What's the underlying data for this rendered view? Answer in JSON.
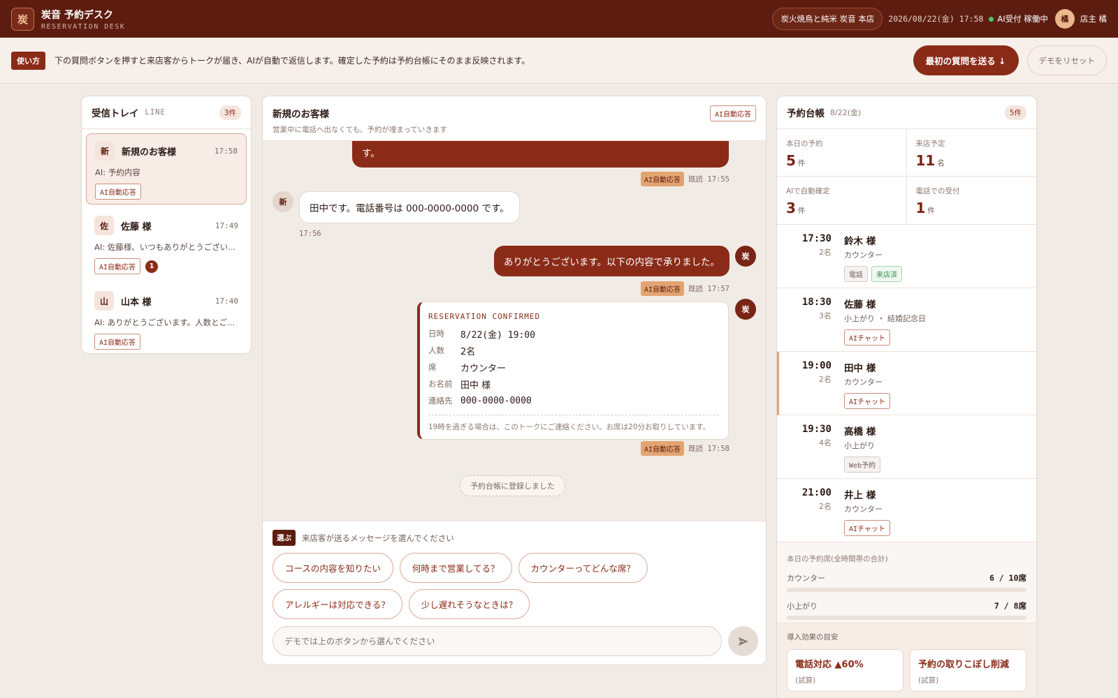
{
  "header": {
    "logo_char": "炭",
    "title": "炭音 予約デスク",
    "subtitle": "RESERVATION DESK",
    "store": "炭火焼鳥と純米 炭音 本店",
    "datetime": "2026/08/22(金) 17:58",
    "status": "AI受付 稼働中",
    "user_avatar": "橘",
    "user_name": "店主 橘"
  },
  "guide": {
    "badge": "使い方",
    "text": "下の質問ボタンを押すと来店客からトークが届き、AIが自動で返信します。確定した予約は予約台帳にそのまま反映されます。",
    "primary_button": "最初の質問を送る ↓",
    "reset_button": "デモをリセット"
  },
  "inbox": {
    "title": "受信トレイ",
    "channel": "LINE",
    "count": "3件",
    "threads": [
      {
        "avatar": "新",
        "name": "新規のお客様",
        "time": "17:58",
        "preview": "AI: 予約内容",
        "tag": "AI自動応答",
        "unread": ""
      },
      {
        "avatar": "佐",
        "name": "佐藤 様",
        "time": "17:49",
        "preview": "AI: 佐藤様、いつもありがとうござい...",
        "tag": "AI自動応答",
        "unread": "1"
      },
      {
        "avatar": "山",
        "name": "山本 様",
        "time": "17:40",
        "preview": "AI: ありがとうございます。人数とご...",
        "tag": "AI自動応答",
        "unread": ""
      }
    ]
  },
  "chat": {
    "title": "新規のお客様",
    "subtitle": "営業中に電話へ出なくても、予約が埋まっていきます",
    "mode_tag": "AI自動応答",
    "messages": {
      "m1_text": "す。",
      "m1_tag": "AI自動応答",
      "m1_meta": "既読 17:55",
      "m2_avatar": "新",
      "m2_text": "田中です。電話番号は 000-0000-0000 です。",
      "m2_time": "17:56",
      "m3_avatar": "炭",
      "m3_text": "ありがとうございます。以下の内容で承りました。",
      "m3_tag": "AI自動応答",
      "m3_meta": "既読 17:57",
      "m4_avatar": "炭",
      "m4_tag": "AI自動応答",
      "m4_meta": "既読 17:58",
      "system": "予約台帳に登録しました"
    },
    "confirmation": {
      "title": "RESERVATION CONFIRMED",
      "rows": [
        {
          "label": "日時",
          "value": "8/22(金) 19:00"
        },
        {
          "label": "人数",
          "value": "2名"
        },
        {
          "label": "席",
          "value": "カウンター"
        },
        {
          "label": "お名前",
          "value": "田中 様"
        },
        {
          "label": "連絡先",
          "value": "000-0000-0000"
        }
      ],
      "note": "19時を過ぎる場合は、このトークにご連絡ください。お席は20分お取りしています。"
    },
    "composer": {
      "choose_badge": "選ぶ",
      "choose_text": "来店客が送るメッセージを選んでください",
      "chips": [
        "コースの内容を知りたい",
        "何時まで営業してる？",
        "カウンターってどんな席？",
        "アレルギーは対応できる？",
        "少し遅れそうなときは？"
      ],
      "placeholder": "デモでは上のボタンから選んでください"
    }
  },
  "ledger": {
    "title": "予約台帳",
    "date": "8/22(金)",
    "count": "5件",
    "stats": [
      {
        "label": "本日の予約",
        "value": "5",
        "unit": "件"
      },
      {
        "label": "来店予定",
        "value": "11",
        "unit": "名"
      },
      {
        "label": "AIで自動確定",
        "value": "3",
        "unit": "件"
      },
      {
        "label": "電話での受付",
        "value": "1",
        "unit": "件"
      }
    ],
    "reservations": [
      {
        "time": "17:30",
        "people": "2名",
        "name": "鈴木 様",
        "detail": "カウンター",
        "tags": [
          "電話",
          "来店済"
        ]
      },
      {
        "time": "18:30",
        "people": "3名",
        "name": "佐藤 様",
        "detail": "小上がり ・ 結婚記念日",
        "tags": [
          "AIチャット"
        ]
      },
      {
        "time": "19:00",
        "people": "2名",
        "name": "田中 様",
        "detail": "カウンター",
        "tags": [
          "AIチャット"
        ]
      },
      {
        "time": "19:30",
        "people": "4名",
        "name": "高橋 様",
        "detail": "小上がり",
        "tags": [
          "Web予約"
        ]
      },
      {
        "time": "21:00",
        "people": "2名",
        "name": "井上 様",
        "detail": "カウンター",
        "tags": [
          "AIチャット"
        ]
      }
    ],
    "capacity": {
      "title": "本日の予約席(全時間帯の合計)",
      "rows": [
        {
          "label": "カウンター",
          "value": "6 / 10席",
          "fill": 0.6
        },
        {
          "label": "小上がり",
          "value": "7 / 8席",
          "fill": 0.875
        }
      ]
    },
    "effect": {
      "title": "導入効果の目安",
      "cards": [
        {
          "main": "電話対応 ▲60%",
          "sub": "(試算)"
        },
        {
          "main": "予約の取りこぼし削減",
          "sub": "(試算)"
        }
      ]
    }
  }
}
